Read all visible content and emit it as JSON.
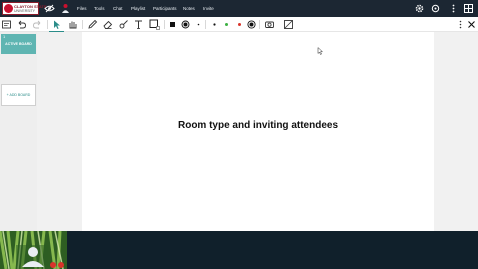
{
  "header": {
    "logo_line1": "CLAYTON STATE",
    "logo_line2": "UNIVERSITY",
    "nav": [
      {
        "label": "Files"
      },
      {
        "label": "Tools"
      },
      {
        "label": "Chat"
      },
      {
        "label": "Playlist"
      },
      {
        "label": "Participants"
      },
      {
        "label": "Notes"
      },
      {
        "label": "Invite"
      }
    ],
    "icons_left": [
      "eye-slash-icon",
      "presenter-icon"
    ],
    "icons_right": [
      "settings-gear-icon",
      "help-icon",
      "more-vert-icon",
      "layout-icon"
    ]
  },
  "toolbar": {
    "tools": [
      "note-icon",
      "undo-icon",
      "redo-icon",
      "select-icon",
      "pan-icon",
      "pencil-icon",
      "eraser-icon",
      "highlighter-icon",
      "text-icon",
      "shape-icon",
      "color-black-icon",
      "color-fill-icon",
      "size-small-icon",
      "size-dot-icon",
      "color-green-icon",
      "color-red-icon",
      "record-icon",
      "camera-icon",
      "image-icon",
      "more-icon",
      "close-icon"
    ],
    "colors": {
      "green": "#3cb043",
      "red": "#d9342b",
      "teal": "#2a8c89"
    }
  },
  "sidebar": {
    "active_board_number": "1",
    "active_board_label": "ACTIVE BOARD",
    "add_board_label": "+ ADD BOARD"
  },
  "main": {
    "slide_title": "Room type and inviting attendees"
  }
}
